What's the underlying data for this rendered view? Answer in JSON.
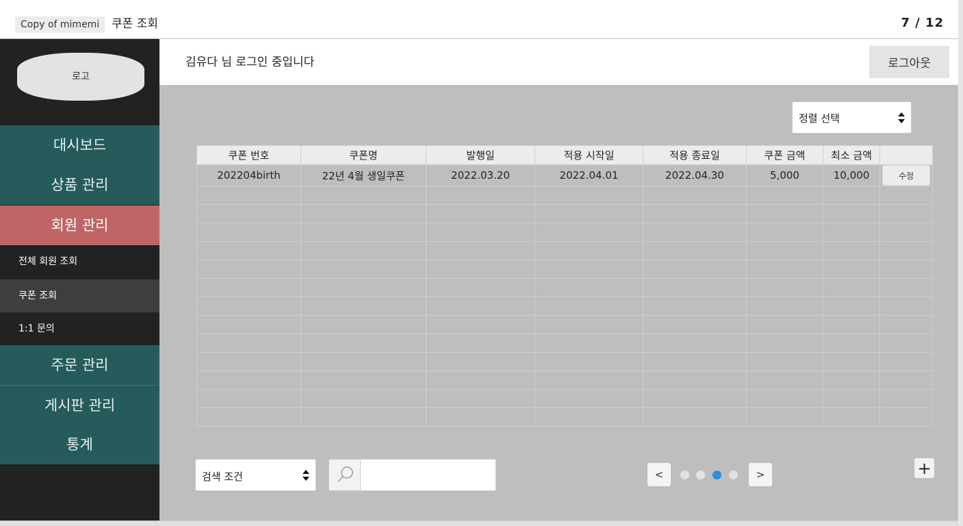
{
  "topbar": {
    "copy_tag": "Copy of mimemi",
    "page_name": "쿠폰 조회",
    "page_count": "7 / 12"
  },
  "sidebar": {
    "logo": "로고",
    "items": [
      {
        "label": "대시보드"
      },
      {
        "label": "상품 관리"
      },
      {
        "label": "회원 관리"
      },
      {
        "label": "주문 관리"
      },
      {
        "label": "게시판 관리"
      },
      {
        "label": "통계"
      }
    ],
    "subitems": [
      {
        "label": "전체 회원 조회"
      },
      {
        "label": "쿠폰 조회"
      },
      {
        "label": "1:1 문의"
      }
    ]
  },
  "header": {
    "welcome": "김유다 님 로그인 중입니다",
    "logout": "로그아웃"
  },
  "sort": {
    "label": "정렬 선택"
  },
  "table": {
    "columns": [
      "쿠폰 번호",
      "쿠폰명",
      "발행일",
      "적용 시작일",
      "적용 종료일",
      "쿠폰 금액",
      "최소 금액",
      ""
    ],
    "rows": [
      [
        "202204birth",
        "22년 4월 생일쿠폰",
        "2022.03.20",
        "2022.04.01",
        "2022.04.30",
        "5,000",
        "10,000"
      ]
    ],
    "edit_label": "수정"
  },
  "search": {
    "condition_label": "검색 조건",
    "placeholder": ""
  },
  "pagination": {
    "prev": "<",
    "next": ">",
    "pages": 4,
    "current": 3
  },
  "add_button": "+",
  "colors": {
    "sidebar_bg": "#222222",
    "nav_teal": "#255c5b",
    "nav_active": "#bf6565",
    "content_bg": "#bebebe",
    "page_dot_active": "#2f8fd8"
  }
}
